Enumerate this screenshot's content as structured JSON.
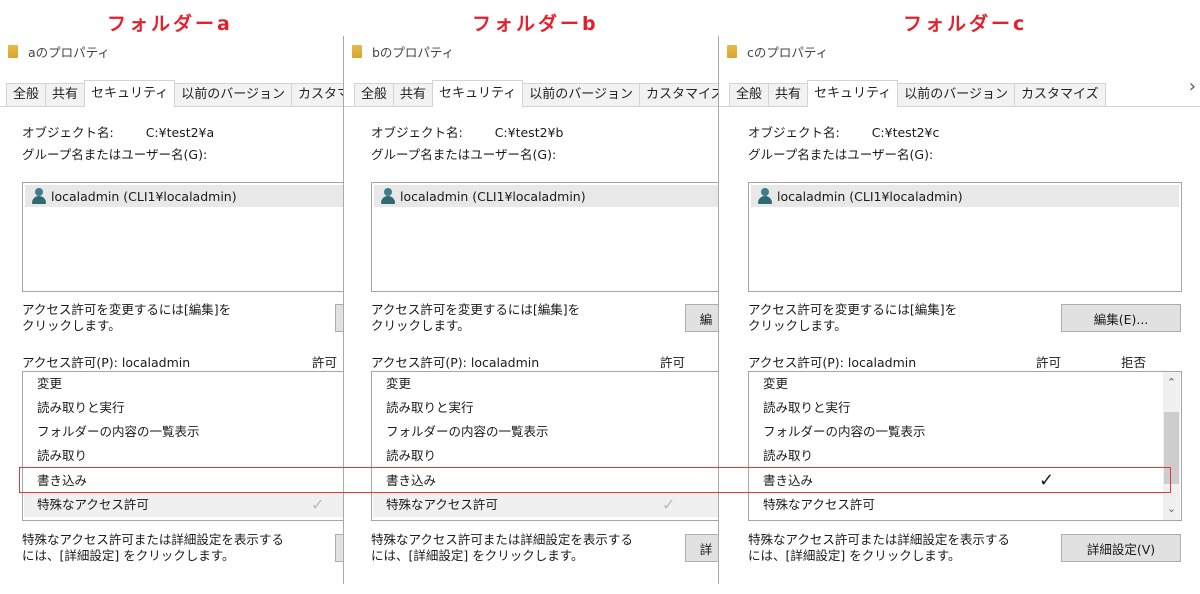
{
  "captions": [
    "フォルダーa",
    "フォルダーb",
    "フォルダーc"
  ],
  "panels": [
    {
      "title": "aのプロパティ",
      "tabs": [
        "全般",
        "共有",
        "セキュリティ",
        "以前のバージョン",
        "カスタマ"
      ],
      "object_label": "オブジェクト名:",
      "object_value": "C:¥test2¥a",
      "group_label": "グループ名またはユーザー名(G):",
      "user": "localadmin (CLI1¥localadmin)",
      "edit_note": [
        "アクセス許可を変更するには[編集]を",
        "クリックします。"
      ],
      "edit_button": "",
      "perm_label": "アクセス許可(P): localadmin",
      "allow_header": "許可",
      "deny_header": "",
      "perms": [
        "変更",
        "読み取りと実行",
        "フォルダーの内容の一覧表示",
        "読み取り",
        "書き込み",
        "特殊なアクセス許可"
      ],
      "adv_note": [
        "特殊なアクセス許可または詳細設定を表示する",
        "には、[詳細設定] をクリックします。"
      ],
      "adv_button": ""
    },
    {
      "title": "bのプロパティ",
      "tabs": [
        "全般",
        "共有",
        "セキュリティ",
        "以前のバージョン",
        "カスタマイズ"
      ],
      "object_label": "オブジェクト名:",
      "object_value": "C:¥test2¥b",
      "group_label": "グループ名またはユーザー名(G):",
      "user": "localadmin (CLI1¥localadmin)",
      "edit_note": [
        "アクセス許可を変更するには[編集]を",
        "クリックします。"
      ],
      "edit_button": "編",
      "perm_label": "アクセス許可(P): localadmin",
      "allow_header": "許可",
      "deny_header": "",
      "perms": [
        "変更",
        "読み取りと実行",
        "フォルダーの内容の一覧表示",
        "読み取り",
        "書き込み",
        "特殊なアクセス許可"
      ],
      "adv_note": [
        "特殊なアクセス許可または詳細設定を表示する",
        "には、[詳細設定] をクリックします。"
      ],
      "adv_button": "詳"
    },
    {
      "title": "cのプロパティ",
      "tabs": [
        "全般",
        "共有",
        "セキュリティ",
        "以前のバージョン",
        "カスタマイズ"
      ],
      "object_label": "オブジェクト名:",
      "object_value": "C:¥test2¥c",
      "group_label": "グループ名またはユーザー名(G):",
      "user": "localadmin (CLI1¥localadmin)",
      "edit_note": [
        "アクセス許可を変更するには[編集]を",
        "クリックします。"
      ],
      "edit_button": "編集(E)...",
      "perm_label": "アクセス許可(P): localadmin",
      "allow_header": "許可",
      "deny_header": "拒否",
      "perms": [
        "変更",
        "読み取りと実行",
        "フォルダーの内容の一覧表示",
        "読み取り",
        "書き込み",
        "特殊なアクセス許可"
      ],
      "adv_note": [
        "特殊なアクセス許可または詳細設定を表示する",
        "には、[詳細設定] をクリックします。"
      ],
      "adv_button": "詳細設定(V)"
    }
  ],
  "checks": {
    "panel_a_special": "✓",
    "panel_b_special": "✓",
    "panel_c_write": "✓"
  },
  "icons": {
    "folder": "folder-icon",
    "user": "user-icon",
    "scroll_up": "chevron-up-icon",
    "scroll_down": "chevron-down-icon",
    "next": "chevron-right-icon"
  },
  "colors": {
    "caption": "#e5202a",
    "highlight_box": "#e03a3a"
  }
}
